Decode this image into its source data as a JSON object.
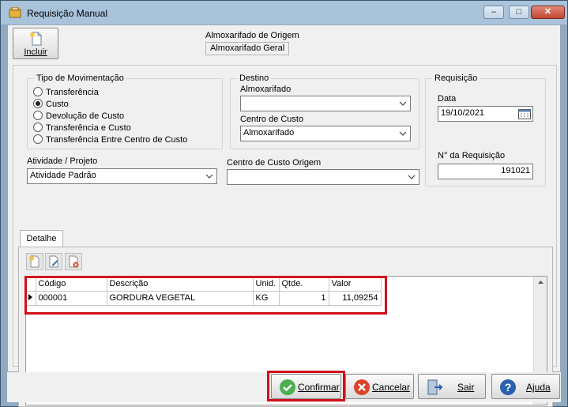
{
  "window": {
    "title": "Requisição Manual",
    "minimize": "–",
    "maximize": "□",
    "close": "✕"
  },
  "toolbar": {
    "include_label": "Incluir"
  },
  "origin": {
    "label": "Almoxarifado de Origem",
    "value": "Almoxarifado Geral"
  },
  "movement": {
    "title": "Tipo de Movimentação",
    "options": [
      "Transferência",
      "Custo",
      "Devolução de Custo",
      "Transferência e Custo",
      "Transferência Entre Centro de Custo"
    ],
    "selected": "Custo"
  },
  "destination": {
    "title": "Destino",
    "warehouse_label": "Almoxarifado",
    "warehouse_value": "",
    "cost_center_label": "Centro de Custo",
    "cost_center_value": "Almoxarifado"
  },
  "requisition": {
    "title": "Requisição",
    "date_label": "Data",
    "date_value": "19/10/2021",
    "number_label": "N°  da Requisição",
    "number_value": "191021"
  },
  "activity": {
    "label": "Atividade / Projeto",
    "value": "Atividade Padrão"
  },
  "origin_cost_center": {
    "label": "Centro de Custo Origem",
    "value": ""
  },
  "detail": {
    "tab": "Detalhe",
    "columns": [
      "Código",
      "Descrição",
      "Unid.",
      "Qtde.",
      "Valor"
    ],
    "rows": [
      {
        "codigo": "000001",
        "descricao": "GORDURA VEGETAL",
        "unid": "KG",
        "qtde": "1",
        "valor": "11,09254"
      }
    ]
  },
  "buttons": {
    "confirm": "Confirmar",
    "cancel": "Cancelar",
    "exit": "Sair",
    "help": "Ajuda"
  },
  "colors": {
    "highlight": "#d0101b",
    "confirm": "#4caf50",
    "cancel": "#d9452b",
    "help": "#2b5fb0"
  }
}
